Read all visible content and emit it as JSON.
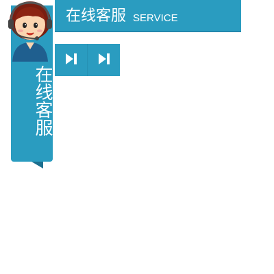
{
  "header": {
    "title": "在线客服",
    "subtitle": "SERVICE"
  },
  "side_tab": {
    "label": "在线客服"
  },
  "buttons": [
    {
      "icon": "skip-next-icon"
    },
    {
      "icon": "skip-next-icon"
    }
  ],
  "colors": {
    "accent": "#2a9cc0",
    "dark_accent": "#1d6f8f",
    "text": "#ffffff"
  }
}
